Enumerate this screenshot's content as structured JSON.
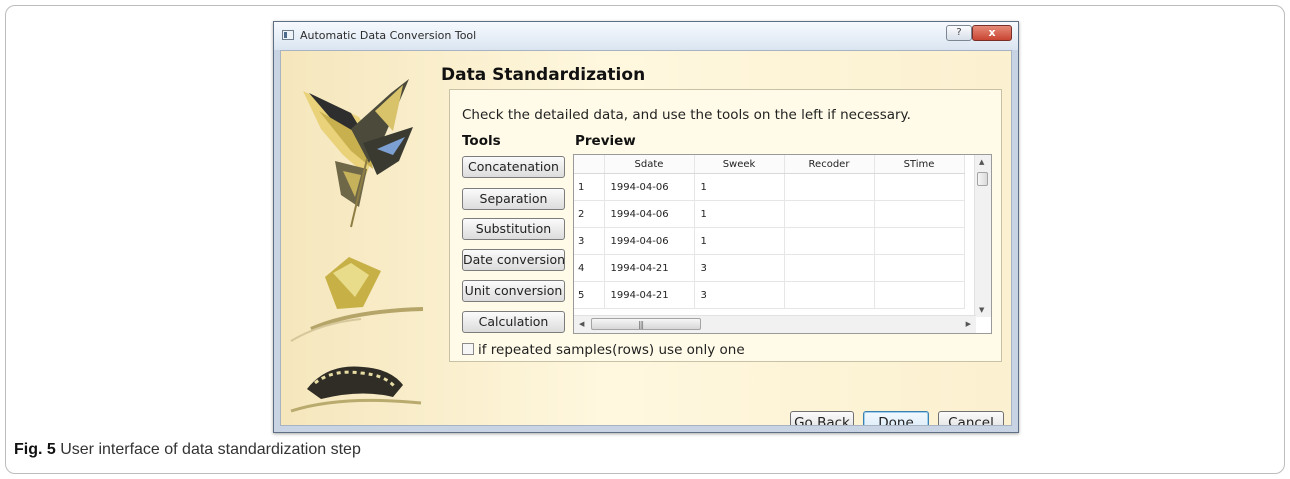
{
  "window": {
    "title": "Automatic Data Conversion Tool",
    "help_label": "?",
    "close_label": "x"
  },
  "page": {
    "heading": "Data Standardization",
    "instruction": "Check the detailed data, and use the tools on the left if necessary.",
    "tools_label": "Tools",
    "preview_label": "Preview",
    "checkbox_label": "if repeated samples(rows) use only one",
    "checkbox_checked": false
  },
  "tools": [
    {
      "label": "Concatenation"
    },
    {
      "label": "Separation"
    },
    {
      "label": "Substitution"
    },
    {
      "label": "Date conversion"
    },
    {
      "label": "Unit conversion"
    },
    {
      "label": "Calculation"
    }
  ],
  "preview": {
    "columns": [
      "",
      "Sdate",
      "Sweek",
      "Recoder",
      "STime"
    ],
    "rows": [
      [
        "1",
        "1994-04-06",
        "1",
        "",
        ""
      ],
      [
        "2",
        "1994-04-06",
        "1",
        "",
        ""
      ],
      [
        "3",
        "1994-04-06",
        "1",
        "",
        ""
      ],
      [
        "4",
        "1994-04-21",
        "3",
        "",
        ""
      ],
      [
        "5",
        "1994-04-21",
        "3",
        "",
        ""
      ]
    ]
  },
  "buttons": {
    "go_back": "Go Back",
    "done": "Done",
    "cancel": "Cancel"
  },
  "caption": {
    "label": "Fig. 5",
    "text": " User interface of data standardization step"
  }
}
